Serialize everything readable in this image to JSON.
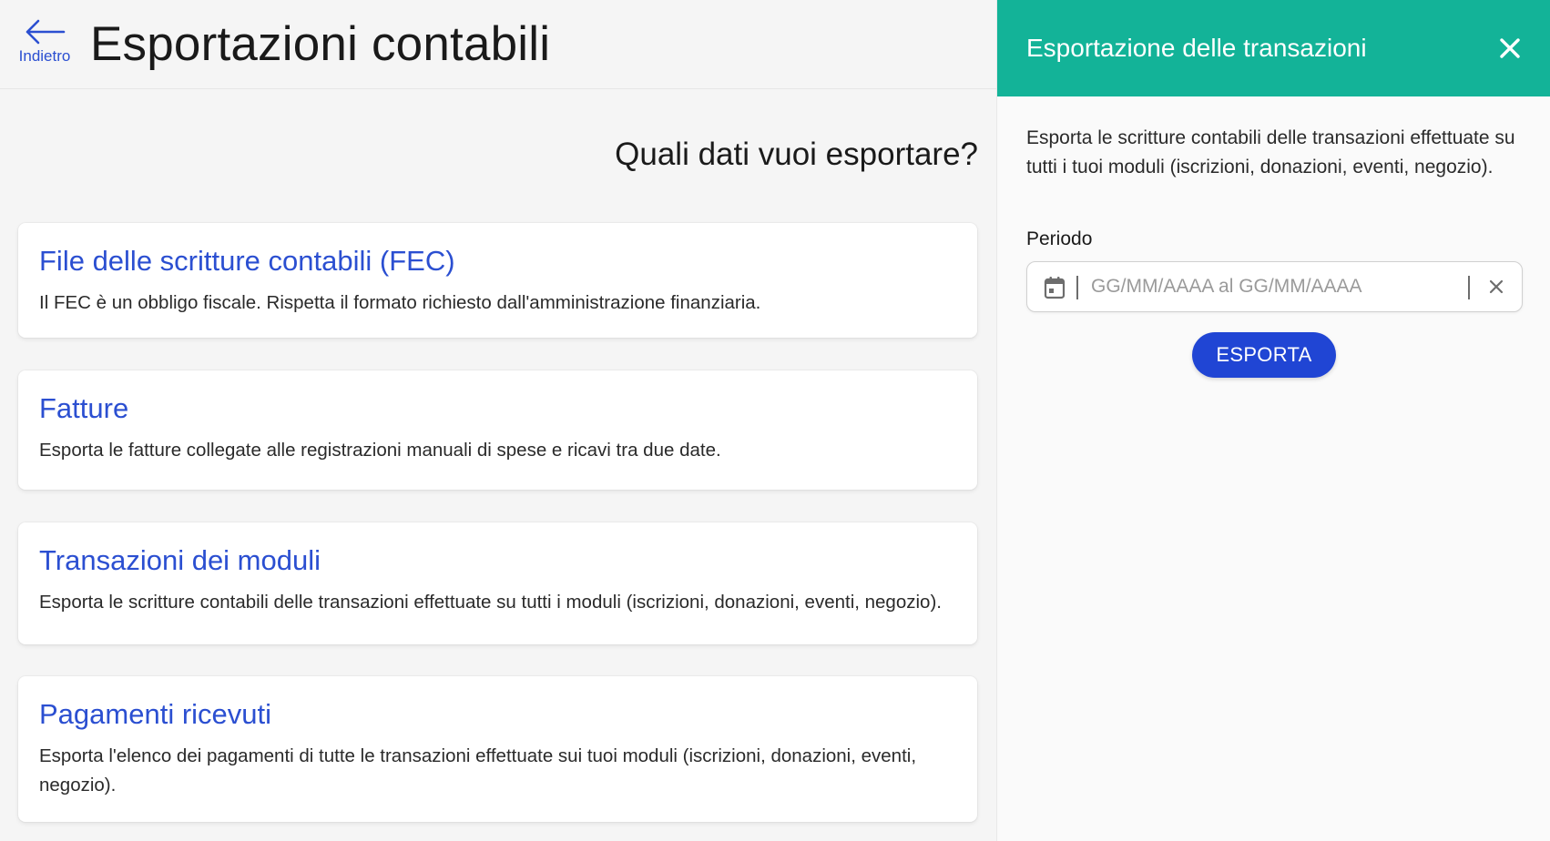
{
  "header": {
    "back_label": "Indietro",
    "title": "Esportazioni contabili"
  },
  "main": {
    "question": "Quali dati vuoi esportare?",
    "cards": [
      {
        "title": "File delle scritture contabili (FEC)",
        "description": "Il FEC è un obbligo fiscale. Rispetta il formato richiesto dall'amministrazione finanziaria."
      },
      {
        "title": "Fatture",
        "description": "Esporta le fatture collegate alle registrazioni manuali di spese e ricavi tra due date."
      },
      {
        "title": "Transazioni dei moduli",
        "description": "Esporta le scritture contabili delle transazioni effettuate su tutti i moduli (iscrizioni, donazioni, eventi, negozio)."
      },
      {
        "title": "Pagamenti ricevuti",
        "description": "Esporta l'elenco dei pagamenti di tutte le transazioni effettuate sui tuoi moduli (iscrizioni, donazioni, eventi, negozio)."
      }
    ]
  },
  "panel": {
    "title": "Esportazione delle transazioni",
    "description": "Esporta le scritture contabili delle transazioni effettuate su tutti i tuoi moduli (iscrizioni, donazioni, eventi, negozio).",
    "period_label": "Periodo",
    "date_value": "",
    "date_placeholder": "GG/MM/AAAA al GG/MM/AAAA",
    "export_label": "ESPORTA"
  },
  "colors": {
    "accent_blue": "#2b4fd1",
    "button_blue": "#2045d4",
    "header_green": "#13b398"
  },
  "icons": {
    "back": "arrow-left-icon",
    "close": "close-icon",
    "calendar": "calendar-icon",
    "clear": "clear-icon"
  }
}
